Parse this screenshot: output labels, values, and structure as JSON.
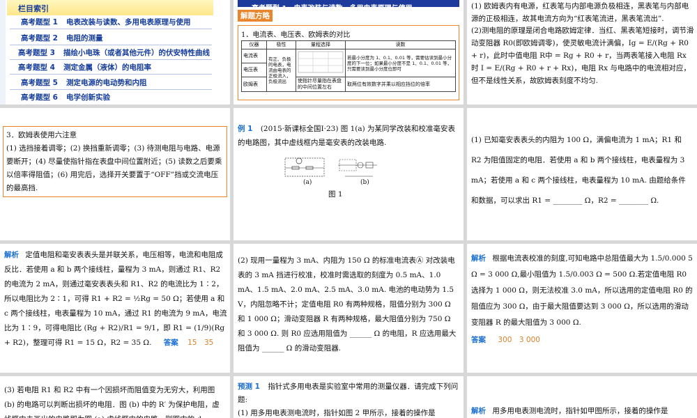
{
  "index": {
    "header": "栏目索引",
    "items": [
      {
        "key": "高考题型 1",
        "text": "电表改装与读数、多用电表原理与使用"
      },
      {
        "key": "高考题型 2",
        "text": "电阻的测量"
      },
      {
        "key": "高考题型 3",
        "text": "描绘小电珠（或者其他元件）的伏安特性曲线"
      },
      {
        "key": "高考题型 4",
        "text": "测定金属（液体）的电阻率"
      },
      {
        "key": "高考题型 5",
        "text": "测定电源的电动势和内阻"
      },
      {
        "key": "高考题型 6",
        "text": "电学创新实验"
      }
    ]
  },
  "slide2": {
    "title": "高考题型 1　电表改装与读数、多用电表原理与使用",
    "badge": "解题方略",
    "heading": "1．电流表、电压表、欧姆表的对比",
    "table": {
      "headers": [
        "仪器",
        "极性",
        "量程选择",
        "读数"
      ],
      "rows": [
        {
          "name": "电流表",
          "reading": "若最小分度为 1、0.1、0.01 等，需要估读到最小分度的下一位；如果最小分度不是 1、0.1、0.01 等，只需要读到最小分度位即可"
        },
        {
          "name": "电压表"
        },
        {
          "name": "欧姆表",
          "range": "使指针尽量指在表盘的中间位置左右",
          "reading": "取两位有效数字并乘以相应挡位的倍率"
        }
      ],
      "polarity": "有正、负极的电表，电流由电表的正极流入，负极流出"
    }
  },
  "slide3": {
    "p1": "(1) 欧姆表内有电源，红表笔与内部电源负极相连，黑表笔与内部电源的正极相连，故其电流方向为“红表笔流进，黑表笔流出”.",
    "p2": "(2)测电阻的原理是闭合电路欧姆定律．当红、黑表笔短接时，调节滑动变阻器 R0(即欧姆调零)，使灵敏电流计满偏，Ig = E/(Rg + R0 + r)，此时中值电阻 R中 = Rg + R0 + r，当两表笔接入电阻 Rx 时 I = E/(Rg + R0 + r + Rx)，电阻 Rx 与电路中的电流相对应，但不是线性关系，故欧姆表刻度不均匀."
  },
  "slide4": {
    "text": "3．欧姆表使用六注意\n(1) 选挡接着调零；(2) 换挡重新调零；(3) 待测电阻与电路、电源要断开；(4) 尽量使指针指在表盘中间位置附近；(5) 读数之后要乘以倍率得阻值；(6) 用完后，选择开关要置于“OFF”挡或交流电压的最高挡."
  },
  "slide5": {
    "tag": "例 1",
    "text": "(2015·新课标全国Ⅰ·23) 图 1(a) 为某同学改装和校准毫安表的电路图，其中虚线框内是毫安表的改装电路.",
    "fig_a": "(a)",
    "fig_b": "(b)",
    "caption": "图 1"
  },
  "slide6": {
    "text": "(1) 已知毫安表表头的内阻为 100 Ω，满偏电流为 1 mA；R1 和 R2 为阻值固定的电阻．若使用 a 和 b 两个接线柱，电表量程为 3 mA；若使用 a 和 c 两个接线柱，电表量程为 10 mA. 由题给条件和数据，可以求出 R1 = ________ Ω，R2 = ________ Ω."
  },
  "slide7": {
    "tag": "解析",
    "text": "定值电阻和毫安表表头是并联关系，电压相等，电流和电阻成反比．若使用 a 和 b 两个接线柱，量程为 3 mA，则通过 R1、R2 的电流为 2 mA，则通过毫安表表头和 R1、R2 的电流比为 1∶2，所以电阻比为 2∶1，可得 R1 + R2 = ½Rg = 50 Ω；若使用 a 和 c 两个接线柱，电表量程为 10 mA，通过 R1 的电流为 9 mA，电流比为 1∶9，可得电阻比 (Rg + R2)/R1 = 9/1，即 R1 = (1/9)(Rg + R2)，整理可得 R1 = 15 Ω，R2 = 35 Ω.",
    "answer_label": "答案",
    "answer": "15　35"
  },
  "slide8": {
    "text": "(2) 现用一量程为 3 mA、内阻为 150 Ω 的标准电流表Ⓐ 对改装电表的 3 mA 挡进行校准，校准时需选取的刻度为 0.5 mA、1.0 mA、1.5 mA、2.0 mA、2.5 mA、3.0 mA. 电池的电动势为 1.5 V，内阻忽略不计；定值电阻 R0 有两种规格，阻值分别为 300 Ω 和 1 000 Ω；滑动变阻器 R 有两种规格，最大阻值分别为 750 Ω 和 3 000 Ω. 则 R0 应选用阻值为 ______ Ω 的电阻，R 应选用最大阻值为 ______ Ω 的滑动变阻器."
  },
  "slide9": {
    "tag": "解析",
    "text": "根据电流表校准的刻度,可知电路中总阻值最大为 1.5/0.000 5 Ω = 3 000 Ω,最小阻值为 1.5/0.003 Ω = 500 Ω.若定值电阻 R0 选择为 1 000 Ω，则无法校准 3.0 mA，所以选用的定值电阻 R0 的阻值应为 300 Ω，由于最大阻值要达到 3 000 Ω，所以选用的滑动变阻器 R 的最大阻值为 3 000 Ω.",
    "answer_label": "答案",
    "answer": "300　3 000"
  },
  "slide10": {
    "text": "(3) 若电阻 R1 和 R2 中有一个因损坏而阻值变为无穷大，利用图 (b) 的电路可以判断出损坏的电阻．图 (b) 中的 R′ 为保护电阻，虚线框内未画出的电路即为图 (a) 虚线框内的电路．则图中的 d"
  },
  "slide11": {
    "tag": "预测 1",
    "text": "指针式多用电表是实验室中常用的测量仪器．请完成下列问题:\n(1) 用多用电表测电流时，指针如图 2 甲所示，接着的操作是"
  },
  "slide12": {
    "tag": "解析",
    "text": "用多用电表测电流时，指针如甲图所示，接着的操作是"
  }
}
